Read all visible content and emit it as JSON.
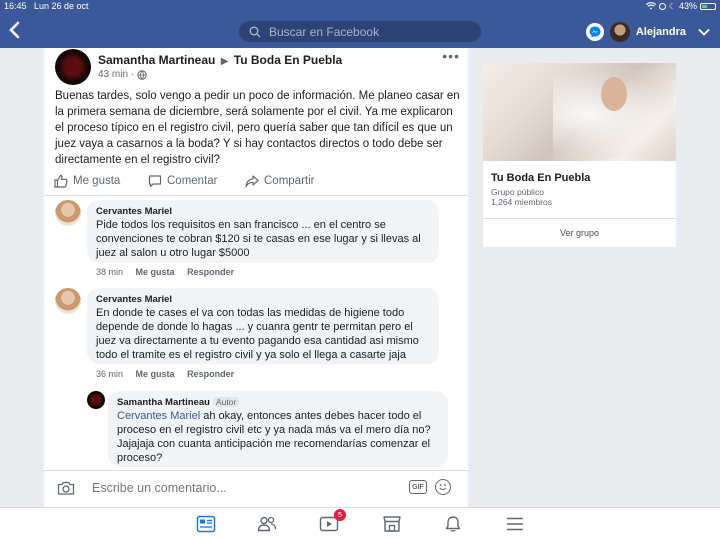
{
  "status": {
    "time": "16:45",
    "date": "Lun 26 de oct",
    "battery": "43%",
    "battery_level": 0.43
  },
  "header": {
    "search_placeholder": "Buscar en Facebook",
    "user_name": "Alejandra"
  },
  "post": {
    "author": "Samantha Martineau",
    "group": "Tu Boda En Puebla",
    "time": "43 min",
    "text": "Buenas tardes, solo vengo a pedir un poco de información. Me planeo casar en la primera semana de diciembre, será solamente por el civil. Ya me explicaron el proceso típico en el registro civil, pero quería saber que tan difícil es que un juez vaya a casarnos a la boda? Y si hay contactos directos o todo debe ser directamente en el registro civil?",
    "actions": {
      "like": "Me gusta",
      "comment": "Comentar",
      "share": "Compartir"
    }
  },
  "comments": [
    {
      "name": "Cervantes Mariel",
      "text": "Pide  todos los requisitos en san francisco  ...  en el centro se convenciones te cobran $120 si te casas en ese lugar y si llevas al juez al salon u otro lugar $5000",
      "time": "38 min",
      "like": "Me gusta",
      "reply": "Responder"
    },
    {
      "name": "Cervantes Mariel",
      "text": "En donde te cases el va con todas las medidas de higiene todo depende de donde lo hagas ...  y cuanra gentr te permitan pero el juez va directamente a tu evento pagando esa cantidad asi mismo todo el tramite es el registro civil y ya solo el llega a casarte jaja",
      "time": "36 min",
      "like": "Me gusta",
      "reply": "Responder"
    }
  ],
  "reply": {
    "name": "Samantha Martineau",
    "badge": "Autor",
    "mention": "Cervantes Mariel",
    "text": " ah okay, entonces antes debes hacer todo el proceso en el registro civil etc y ya nada más va el mero día no? Jajajaja con cuanta anticipación me recomendarías comenzar el proceso?"
  },
  "composer": {
    "placeholder": "Escribe un comentario...",
    "gif": "GIF"
  },
  "group_card": {
    "name": "Tu Boda En Puebla",
    "type": "Grupo público",
    "members": "1,264 miembros",
    "button": "Ver grupo"
  },
  "nav": {
    "video_badge": "5"
  },
  "colors": {
    "brand": "#3b5998",
    "link": "#385898",
    "badge": "#e41e3f"
  }
}
